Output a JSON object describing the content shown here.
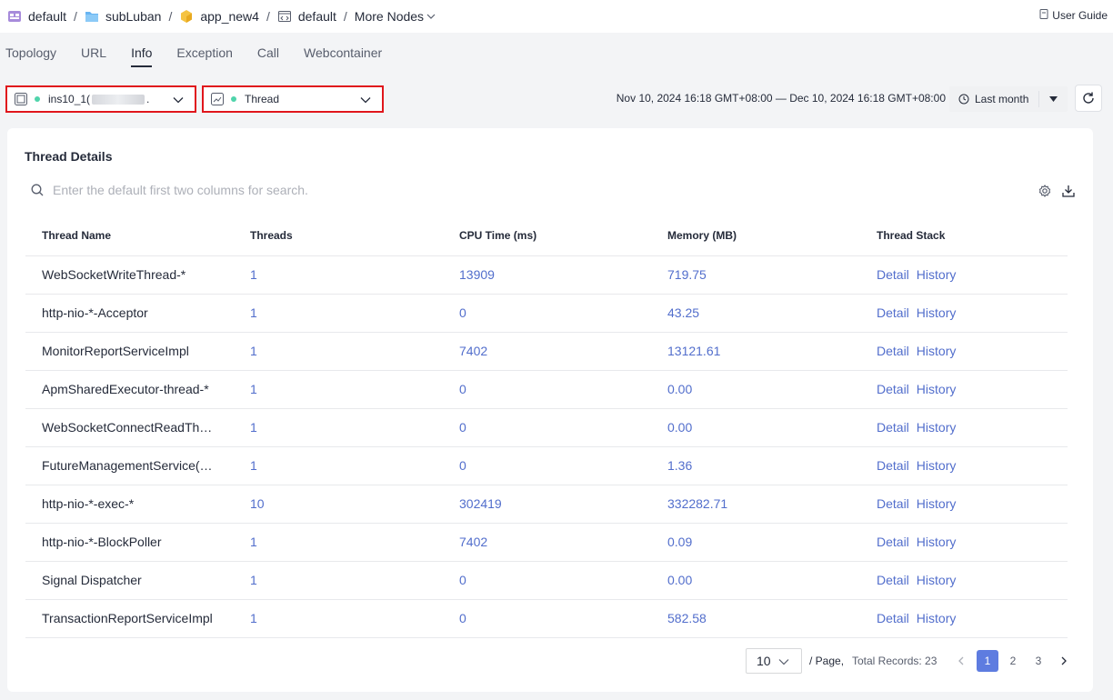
{
  "breadcrumb": {
    "items": [
      "default",
      "subLuban",
      "app_new4",
      "default"
    ],
    "separator": "/",
    "more_nodes": "More Nodes"
  },
  "user_guide": "User Guide",
  "tabs": [
    "Topology",
    "URL",
    "Info",
    "Exception",
    "Call",
    "Webcontainer"
  ],
  "active_tab": "Info",
  "instance_select": {
    "value": "ins10_1(",
    "value_tail": "."
  },
  "type_select": {
    "value": "Thread"
  },
  "time_range": "Nov 10, 2024 16:18 GMT+08:00 — Dec 10, 2024 16:18 GMT+08:00",
  "time_preset": "Last month",
  "card": {
    "title": "Thread Details",
    "search_placeholder": "Enter the default first two columns for search."
  },
  "table": {
    "headers": [
      "Thread Name",
      "Threads",
      "CPU Time (ms)",
      "Memory (MB)",
      "Thread Stack"
    ],
    "rows": [
      [
        "WebSocketWriteThread-*",
        "1",
        "13909",
        "719.75"
      ],
      [
        "http-nio-*-Acceptor",
        "1",
        "0",
        "43.25"
      ],
      [
        "MonitorReportServiceImpl",
        "1",
        "7402",
        "13121.61"
      ],
      [
        "ApmSharedExecutor-thread-*",
        "1",
        "0",
        "0.00"
      ],
      [
        "WebSocketConnectReadTh…",
        "1",
        "0",
        "0.00"
      ],
      [
        "FutureManagementService(…",
        "1",
        "0",
        "1.36"
      ],
      [
        "http-nio-*-exec-*",
        "10",
        "302419",
        "332282.71"
      ],
      [
        "http-nio-*-BlockPoller",
        "1",
        "7402",
        "0.09"
      ],
      [
        "Signal Dispatcher",
        "1",
        "0",
        "0.00"
      ],
      [
        "TransactionReportServiceImpl",
        "1",
        "0",
        "582.58"
      ]
    ],
    "detail_label": "Detail",
    "history_label": "History"
  },
  "pagination": {
    "page_size": "10",
    "per_page_label": "/ Page,",
    "total_label": "Total Records: 23",
    "pages": [
      "1",
      "2",
      "3"
    ],
    "current": "1"
  },
  "colors": {
    "accent": "#5e7ce0",
    "link": "#526ecc",
    "highlight_border": "#e0161c",
    "status_dot": "#50d4ab"
  }
}
